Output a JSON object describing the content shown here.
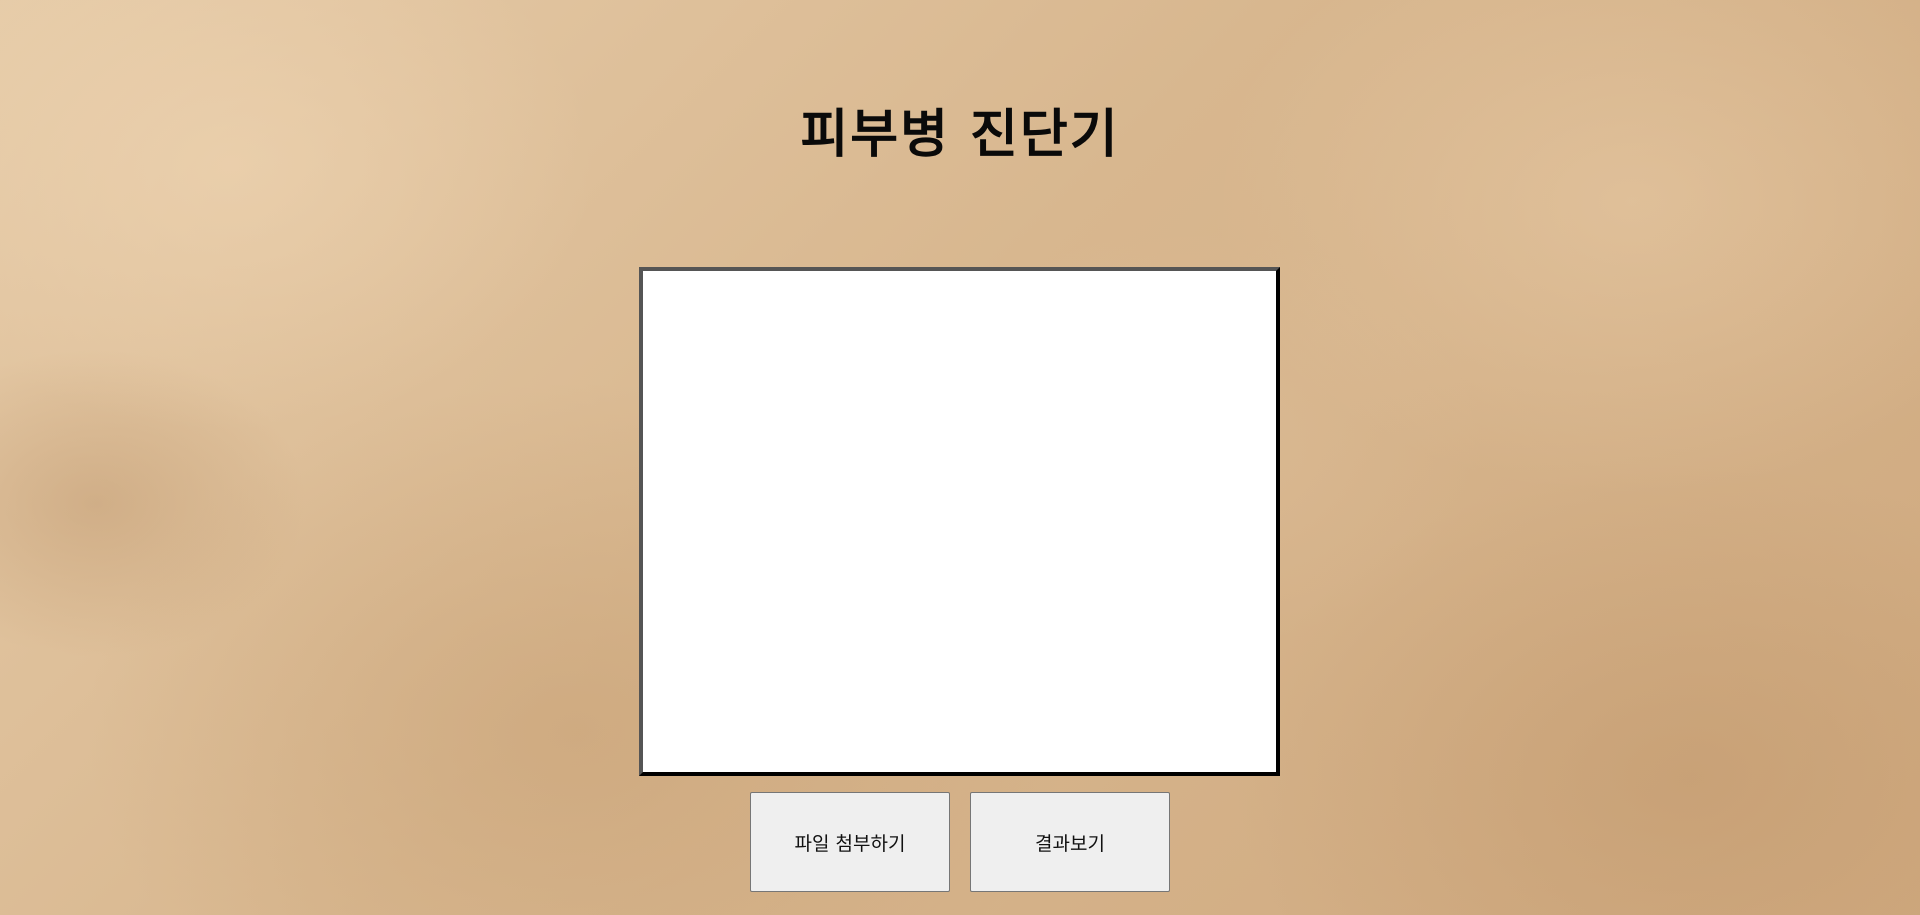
{
  "page": {
    "title": "피부병 진단기",
    "background_color": "#d9b994"
  },
  "preview": {
    "background_color": "#ffffff"
  },
  "buttons": {
    "attach_label": "파일 첨부하기",
    "result_label": "결과보기"
  }
}
